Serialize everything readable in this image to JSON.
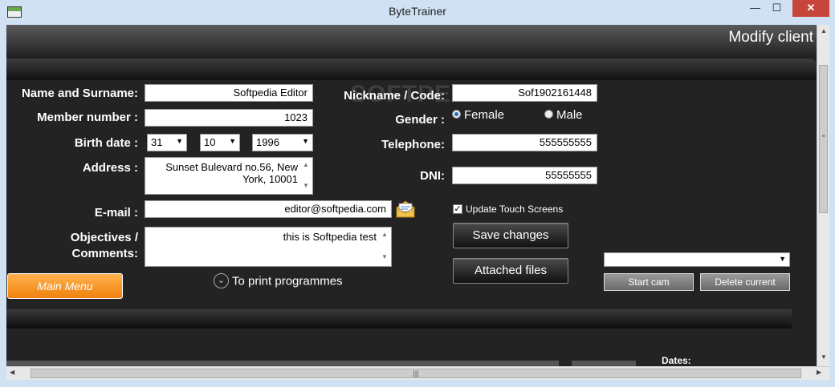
{
  "window": {
    "title": "ByteTrainer",
    "minimize": "—",
    "maximize": "☐",
    "close": "✕"
  },
  "screen_title": "Modify client",
  "watermark": "SOFTPEDIA",
  "left": {
    "name_label": "Name and Surname:",
    "name_value": "Softpedia Editor",
    "member_label": "Member number :",
    "member_value": "1023",
    "birth_label": "Birth date :",
    "birth_day": "31",
    "birth_month": "10",
    "birth_year": "1996",
    "address_label": "Address :",
    "address_line1": "Sunset Bulevard no.56, New",
    "address_line2": "York, 10001",
    "email_label": "E-mail :",
    "email_value": "editor@softpedia.com",
    "objectives_label1": "Objectives /",
    "objectives_label2": "Comments:",
    "objectives_value": "this is Softpedia test",
    "main_menu": "Main Menu",
    "print_link": "To print programmes"
  },
  "right": {
    "nickname_label": "Nickname / Code:",
    "nickname_value": "Sof1902161448",
    "gender_label": "Gender :",
    "gender_female": "Female",
    "gender_male": "Male",
    "telephone_label": "Telephone:",
    "telephone_value": "555555555",
    "dni_label": "DNI:",
    "dni_value": "55555555",
    "update_touch": "Update Touch Screens",
    "save_changes": "Save changes",
    "attached_files": "Attached files"
  },
  "camera": {
    "camera_select_value": "",
    "start_cam": "Start cam",
    "delete_current": "Delete current"
  },
  "bottom": {
    "dates_label": "Dates:"
  },
  "icons": {
    "select_arrow": "▼",
    "scroll_up": "▲",
    "scroll_down": "▼",
    "scroll_left": "◀",
    "scroll_right": "▶",
    "grip": "|||",
    "circle_chevron": "⌄",
    "check": "✓"
  }
}
